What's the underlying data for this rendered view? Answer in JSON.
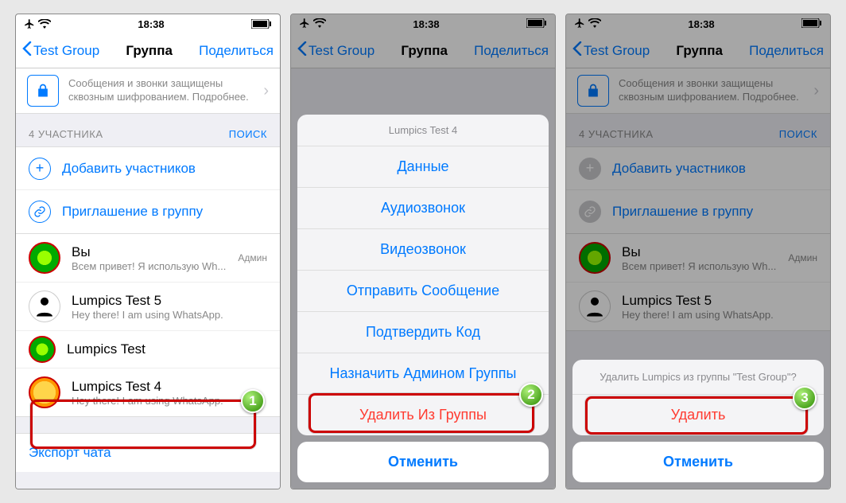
{
  "status": {
    "time": "18:38"
  },
  "nav": {
    "back": "Test Group",
    "title": "Группа",
    "share": "Поделиться"
  },
  "encryption": "Сообщения и звонки защищены сквозным шифрованием. Подробнее.",
  "section": {
    "count_label": "4 УЧАСТНИКА",
    "search": "ПОИСК"
  },
  "actions": {
    "add": "Добавить участников",
    "invite": "Приглашение в группу"
  },
  "you": {
    "name": "Вы",
    "status": "Всем привет! Я использую Wh...",
    "role": "Админ"
  },
  "members": [
    {
      "name": "Lumpics Test 5",
      "status": "Hey there! I am using WhatsApp."
    },
    {
      "name": "Lumpics Test",
      "status": ""
    },
    {
      "name": "Lumpics Test 4",
      "status": "Hey there! I am using WhatsApp."
    }
  ],
  "export": "Экспорт чата",
  "sheet": {
    "title": "Lumpics Test 4",
    "items": [
      "Данные",
      "Аудиозвонок",
      "Видеозвонок",
      "Отправить Сообщение",
      "Подтвердить Код",
      "Назначить Админом Группы"
    ],
    "remove": "Удалить Из Группы",
    "cancel": "Отменить"
  },
  "confirm": {
    "question": "Удалить Lumpics из группы \"Test Group\"?",
    "delete": "Удалить",
    "cancel": "Отменить"
  },
  "badges": {
    "b1": "1",
    "b2": "2",
    "b3": "3"
  }
}
